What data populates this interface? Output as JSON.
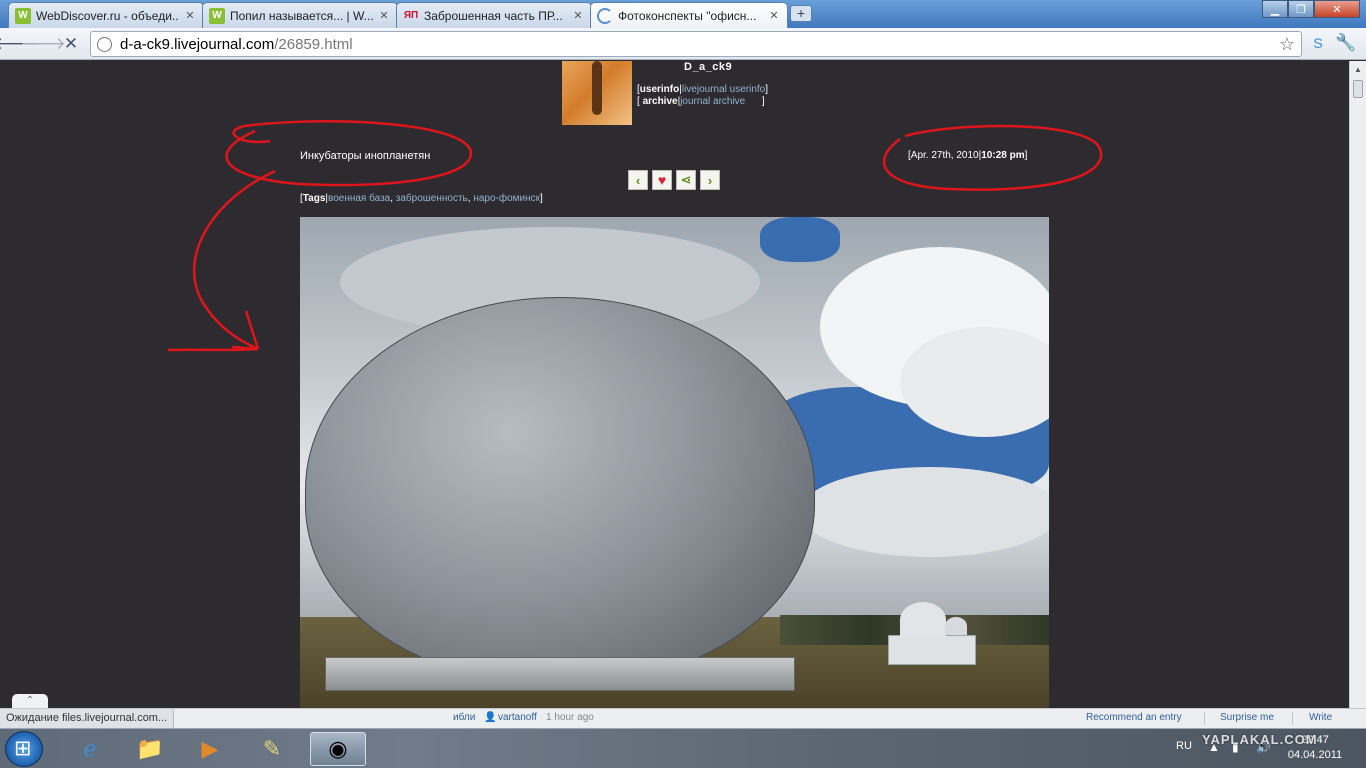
{
  "browser": {
    "tabs": [
      {
        "title": "WebDiscover.ru - объеди...",
        "favicon": "webdiscover-icon"
      },
      {
        "title": "Попил называется... | W...",
        "favicon": "webdiscover-icon"
      },
      {
        "title": "Заброшенная часть ПР...",
        "favicon": "yaplakal-icon"
      },
      {
        "title": "Фотоконспекты \"офисн...",
        "favicon": "loading-icon"
      }
    ],
    "new_tab": "+",
    "url_host": "d-a-ck9.livejournal.com",
    "url_path": "/26859.html"
  },
  "journal": {
    "username": "D_a_ck9",
    "userinfo": {
      "label": "userinfo",
      "link": "livejournal userinfo"
    },
    "archive": {
      "label": "archive",
      "link": "journal archive"
    }
  },
  "post": {
    "title": "Инкубаторы инопланетян",
    "date": "Apr. 27th, 2010",
    "time": "10:28 pm",
    "tags_label": "Tags",
    "tags": [
      "военная база",
      "заброшенность",
      "наро-фоминск"
    ]
  },
  "statusbar": {
    "status": "Ожидание files.livejournal.com...",
    "friend_frag": "ибли",
    "friend_user": "vartanoff",
    "friend_time": "1 hour ago",
    "recommend": "Recommend an entry",
    "surprise": "Surprise me",
    "write": "Write"
  },
  "taskbar": {
    "lang": "RU",
    "time": "22:47",
    "date": "04.04.2011"
  },
  "watermark": "YAPLAKAL.COM",
  "colors": {
    "page_bg": "#2e2b30",
    "link": "#8fb3cf",
    "annotation": "#e0141b"
  }
}
